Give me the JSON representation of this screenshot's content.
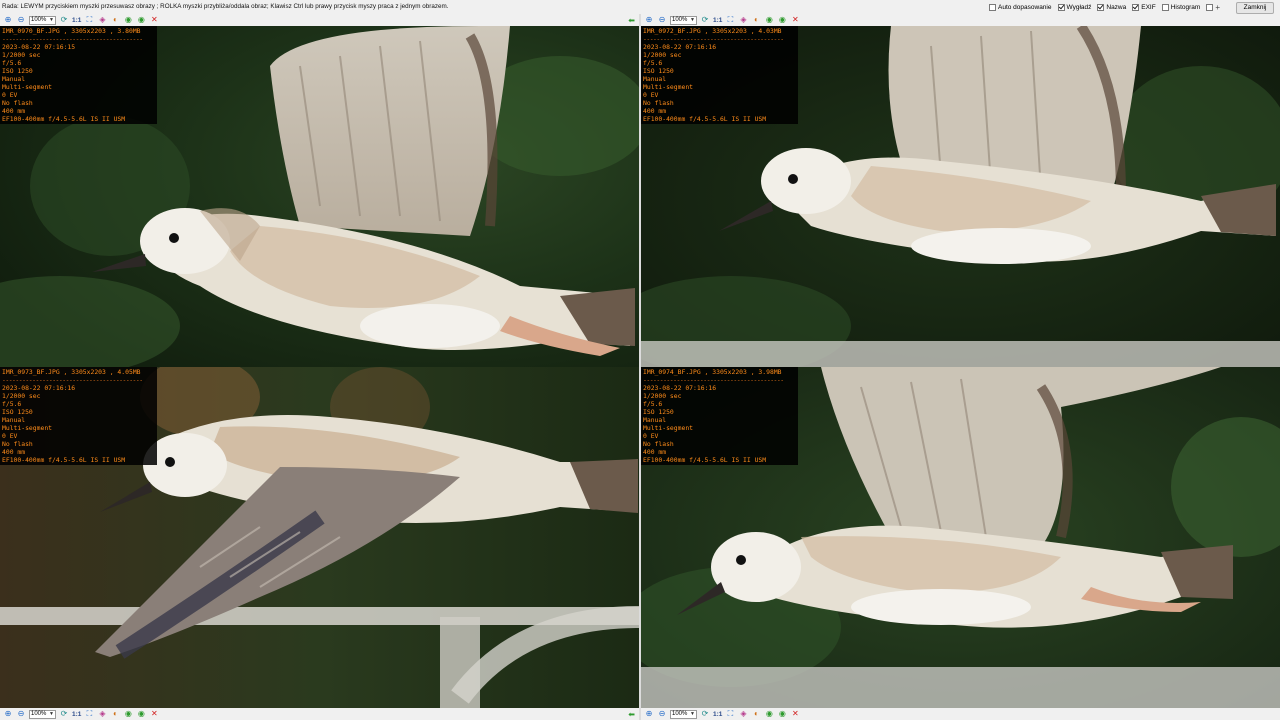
{
  "header": {
    "hint": "Rada: LEWYM przyciskiem myszki przesuwasz obrazy ; ROLKA myszki przybliża/oddala obraz; Klawisz Ctrl lub prawy przycisk myszy praca z jednym obrazem.",
    "options": [
      {
        "label": "Auto dopasowanie",
        "checked": false
      },
      {
        "label": "Wygładź",
        "checked": true
      },
      {
        "label": "Nazwa",
        "checked": true
      },
      {
        "label": "EXIF",
        "checked": true
      },
      {
        "label": "Histogram",
        "checked": false
      }
    ],
    "plus_label": "+",
    "close_label": "Zamknij"
  },
  "toolbar": {
    "zoom_value": "100%",
    "one_to_one": "1:1",
    "icons": [
      "zoom-in-icon",
      "zoom-out-icon",
      "rotate-icon",
      "fit-icon",
      "actual-size-icon",
      "crop-icon",
      "flip-icon",
      "prev-icon",
      "next-icon",
      "close-icon",
      "back-arrow-icon"
    ]
  },
  "panels": [
    {
      "title": "IMR_0970_BF.JPG , 3305x2203 , 3.80MB",
      "dashes": "------------------------------------------",
      "exif": [
        "2023-08-22 07:16:15",
        "1/2000 sec",
        "f/5.6",
        "ISO 1250",
        "Manual",
        "Multi-segment",
        "0 EV",
        "No flash",
        "400 mm",
        "EF100-400mm f/4.5-5.6L IS II USM"
      ]
    },
    {
      "title": "IMR_0972_BF.JPG , 3305x2203 , 4.03MB",
      "dashes": "------------------------------------------",
      "exif": [
        "2023-08-22 07:16:16",
        "1/2000 sec",
        "f/5.6",
        "ISO 1250",
        "Manual",
        "Multi-segment",
        "0 EV",
        "No flash",
        "400 mm",
        "EF100-400mm f/4.5-5.6L IS II USM"
      ]
    },
    {
      "title": "IMR_0973_BF.JPG , 3305x2203 , 4.05MB",
      "dashes": "------------------------------------------",
      "exif": [
        "2023-08-22 07:16:16",
        "1/2000 sec",
        "f/5.6",
        "ISO 1250",
        "Manual",
        "Multi-segment",
        "0 EV",
        "No flash",
        "400 mm",
        "EF100-400mm f/4.5-5.6L IS II USM"
      ]
    },
    {
      "title": "IMR_0974_BF.JPG , 3305x2203 , 3.98MB",
      "dashes": "------------------------------------------",
      "exif": [
        "2023-08-22 07:16:16",
        "1/2000 sec",
        "f/5.6",
        "ISO 1250",
        "Manual",
        "Multi-segment",
        "0 EV",
        "No flash",
        "400 mm",
        "EF100-400mm f/4.5-5.6L IS II USM"
      ]
    }
  ],
  "colors": {
    "exif_text": "#ff8c1a",
    "overlay_bg": "#000000",
    "background_green": "#1f3318",
    "gull_white": "#ece9e0",
    "gull_brown": "#a8876a"
  }
}
